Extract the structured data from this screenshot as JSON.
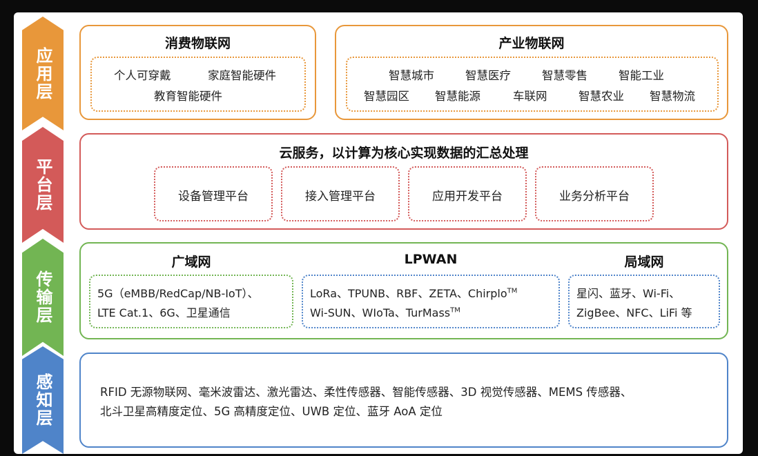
{
  "layers": {
    "application": "应用层",
    "platform": "平台层",
    "transport": "传输层",
    "sensing": "感知层"
  },
  "application": {
    "consumer": {
      "title": "消费物联网",
      "items": [
        "个人可穿戴",
        "家庭智能硬件",
        "教育智能硬件"
      ]
    },
    "industry": {
      "title": "产业物联网",
      "items": [
        "智慧城市",
        "智慧医疗",
        "智慧零售",
        "智能工业",
        "智慧园区",
        "智慧能源",
        "车联网",
        "智慧农业",
        "智慧物流"
      ]
    }
  },
  "platform": {
    "title": "云服务，以计算为核心实现数据的汇总处理",
    "items": [
      "设备管理平台",
      "接入管理平台",
      "应用开发平台",
      "业务分析平台"
    ]
  },
  "transport": {
    "wan": {
      "title": "广域网",
      "line1": "5G（eMBB/RedCap/NB-IoT）、",
      "line2": "LTE Cat.1、6G、卫星通信"
    },
    "lpwan": {
      "title": "LPWAN",
      "line1": "LoRa、TPUNB、RBF、ZETA、Chirplo",
      "line1_sup": "TM",
      "line2": "Wi-SUN、WIoTa、TurMass",
      "line2_sup": "TM"
    },
    "lan": {
      "title": "局域网",
      "line1": "星闪、蓝牙、Wi-Fi、",
      "line2": "ZigBee、NFC、LiFi 等"
    }
  },
  "sensing": {
    "line1": "RFID 无源物联网、毫米波雷达、激光雷达、柔性传感器、智能传感器、3D 视觉传感器、MEMS 传感器、",
    "line2": "北斗卫星高精度定位、5G 高精度定位、UWB 定位、蓝牙 AoA 定位"
  }
}
